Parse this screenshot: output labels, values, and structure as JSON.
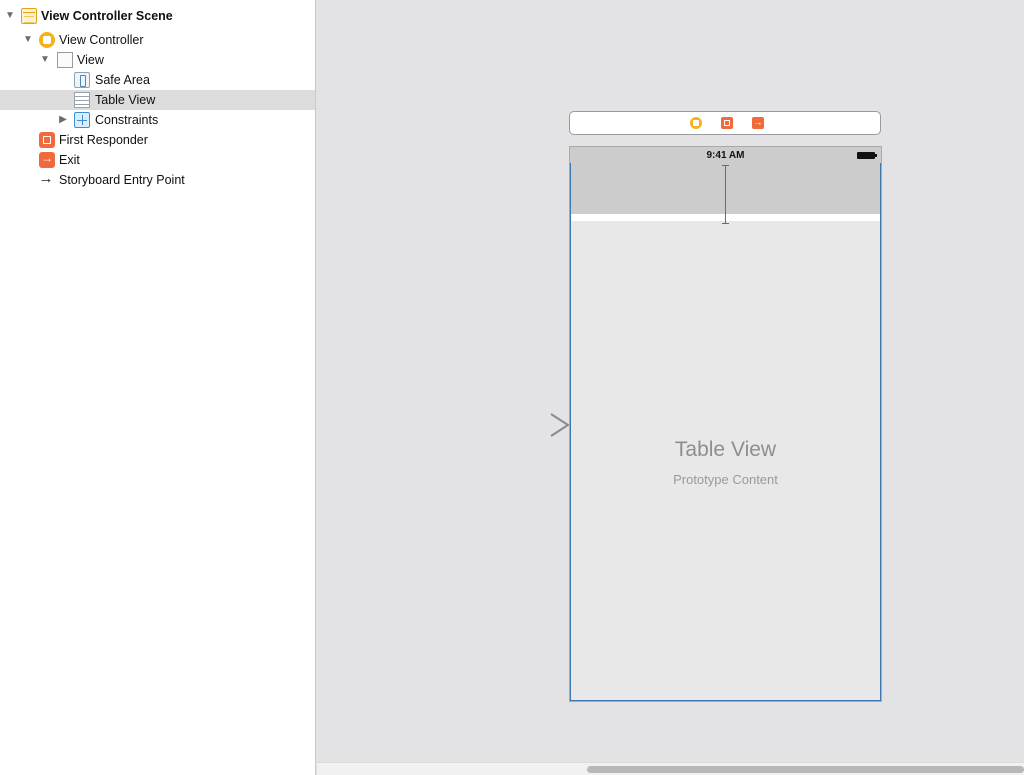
{
  "outline": {
    "items": [
      {
        "label": "View Controller Scene",
        "disclosure": "expanded",
        "icon": "scene-icon"
      },
      {
        "label": "View Controller",
        "disclosure": "expanded",
        "icon": "view-controller-icon"
      },
      {
        "label": "View",
        "disclosure": "expanded",
        "icon": "view-icon"
      },
      {
        "label": "Safe Area",
        "disclosure": "none",
        "icon": "safe-area-icon"
      },
      {
        "label": "Table View",
        "disclosure": "none",
        "icon": "table-view-icon",
        "selected": true
      },
      {
        "label": "Constraints",
        "disclosure": "collapsed",
        "icon": "constraints-icon"
      },
      {
        "label": "First Responder",
        "disclosure": "none",
        "icon": "first-responder-icon"
      },
      {
        "label": "Exit",
        "disclosure": "none",
        "icon": "exit-icon"
      },
      {
        "label": "Storyboard Entry Point",
        "disclosure": "none",
        "icon": "arrow-right-icon"
      }
    ]
  },
  "canvas": {
    "dock_icons": [
      "view-controller-icon",
      "first-responder-icon",
      "exit-icon"
    ],
    "device": {
      "status_time": "9:41 AM",
      "table_view_title": "Table View",
      "table_view_subtitle": "Prototype Content"
    }
  },
  "colors": {
    "selection": "#dcdcdc",
    "constraint_blue": "#3f78b0",
    "view_controller_yellow": "#f5b21a",
    "responder_orange": "#f06a3c"
  }
}
